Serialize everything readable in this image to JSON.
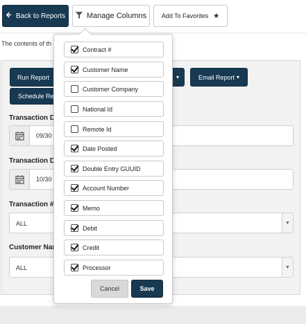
{
  "topbar": {
    "back_label": "Back to Reports",
    "manage_label": "Manage Columns",
    "favorites_label": "Add To Favorites",
    "back_icon": "arrow-left-icon",
    "manage_icon": "filter-icon",
    "favorites_icon": "star-icon"
  },
  "intro_text": "The contents of th",
  "actions": {
    "run_label": "Run Report",
    "email_label": "Email Report",
    "schedule_label": "Schedule Re"
  },
  "filters": {
    "date_from": {
      "label": "Transaction D",
      "value": "09/30"
    },
    "date_to": {
      "label": "Transaction D",
      "value": "10/30"
    },
    "transaction": {
      "label": "Transaction #",
      "value": "ALL"
    },
    "customer": {
      "label": "Customer Nar",
      "value": "ALL"
    }
  },
  "columns_menu": {
    "items": [
      {
        "label": "Contract #",
        "checked": true
      },
      {
        "label": "Customer Name",
        "checked": true
      },
      {
        "label": "Customer Company",
        "checked": false
      },
      {
        "label": "National Id",
        "checked": false
      },
      {
        "label": "Remote Id",
        "checked": false
      },
      {
        "label": "Date Posted",
        "checked": true
      },
      {
        "label": "Double Entry GUUID",
        "checked": true
      },
      {
        "label": "Account Number",
        "checked": true
      },
      {
        "label": "Memo",
        "checked": true
      },
      {
        "label": "Debit",
        "checked": true
      },
      {
        "label": "Credit",
        "checked": true
      },
      {
        "label": "Processor",
        "checked": true
      }
    ],
    "cancel_label": "Cancel",
    "save_label": "Save"
  },
  "colors": {
    "primary": "#173a52",
    "panel": "#f2f2f2",
    "border": "#c9c9c9"
  }
}
